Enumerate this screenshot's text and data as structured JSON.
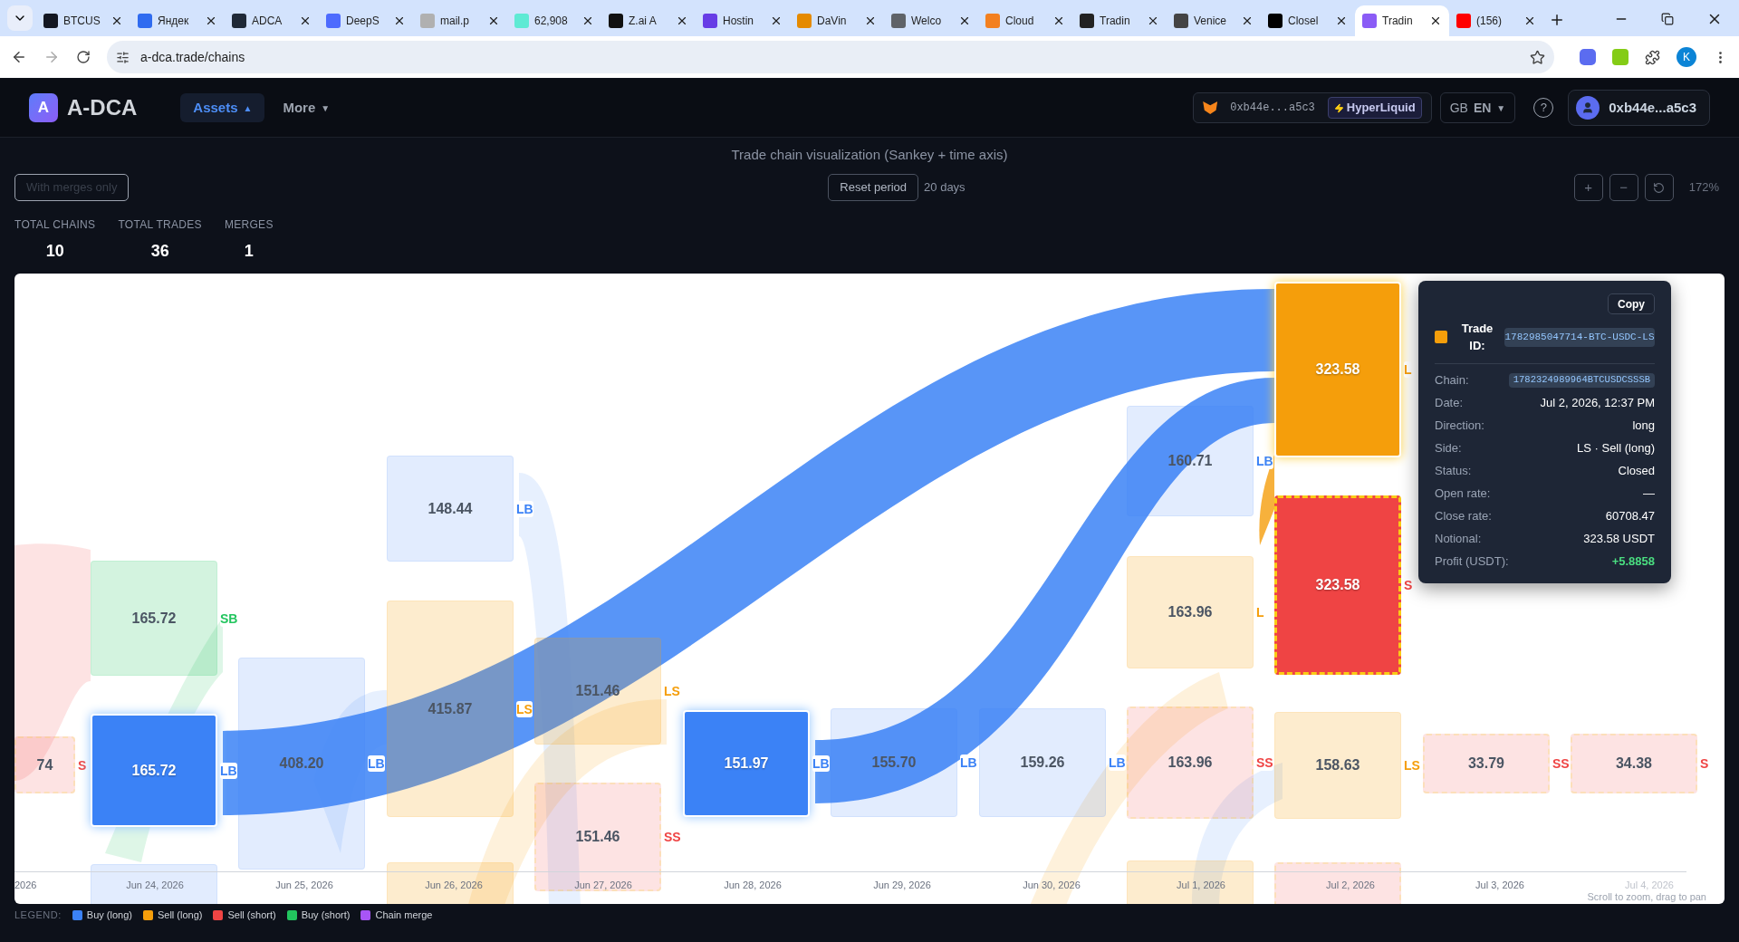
{
  "browser": {
    "tabs": [
      {
        "title": "BTCUS",
        "selected": false,
        "color": "#131722"
      },
      {
        "title": "Яндек",
        "selected": false,
        "color": "#2f6bf0"
      },
      {
        "title": "ADCA",
        "selected": false,
        "color": "#1f2937"
      },
      {
        "title": "DeepS",
        "selected": false,
        "color": "#4d6bfe"
      },
      {
        "title": "mail.p",
        "selected": false,
        "color": "#b0b0b0"
      },
      {
        "title": "62,908",
        "selected": false,
        "color": "#5eead4"
      },
      {
        "title": "Z.ai A",
        "selected": false,
        "color": "#111111"
      },
      {
        "title": "Hostin",
        "selected": false,
        "color": "#673de6"
      },
      {
        "title": "DaVin",
        "selected": false,
        "color": "#e58a00"
      },
      {
        "title": "Welco",
        "selected": false,
        "color": "#5f6368"
      },
      {
        "title": "Cloud",
        "selected": false,
        "color": "#f38020"
      },
      {
        "title": "Tradin",
        "selected": false,
        "color": "#222222"
      },
      {
        "title": "Venice",
        "selected": false,
        "color": "#444444"
      },
      {
        "title": "Closel",
        "selected": false,
        "color": "#000000"
      },
      {
        "title": "Tradin",
        "selected": true,
        "color": "#8b5cf6"
      },
      {
        "title": "(156)",
        "selected": false,
        "color": "#ff0000"
      }
    ],
    "url": "a-dca.trade/chains",
    "profile": "K"
  },
  "header": {
    "logo_letter": "A",
    "brand": "A-DCA",
    "nav": [
      {
        "label": "Assets",
        "caret": "▲",
        "selected": true
      },
      {
        "label": "More",
        "caret": "▼",
        "selected": false
      }
    ],
    "wallet": {
      "address": "0xb44e...a5c3",
      "network": "HyperLiquid"
    },
    "language": {
      "region": "GB",
      "code": "EN",
      "caret": "▼"
    },
    "help": "?",
    "account": "0xb44e...a5c3"
  },
  "toolbar": {
    "title": "Trade chain visualization (Sankey + time axis)",
    "filter": {
      "label": "With merges only",
      "on": false
    },
    "reset": "Reset period",
    "period": "20 days",
    "zoom_in": "+",
    "zoom_out": "−",
    "zoom_level": "172%"
  },
  "stats": [
    {
      "label": "TOTAL CHAINS",
      "value": "10"
    },
    {
      "label": "TOTAL TRADES",
      "value": "36"
    },
    {
      "label": "MERGES",
      "value": "1"
    }
  ],
  "chart": {
    "nodes": [
      {
        "value": "74",
        "tag": "S",
        "kind": "short-sell",
        "highlighted": false
      },
      {
        "value": "165.72",
        "tag": "SB",
        "kind": "short-buy",
        "highlighted": false
      },
      {
        "value": "165.72",
        "tag": "LB",
        "kind": "long-buy",
        "highlighted": true
      },
      {
        "value": "408.20",
        "tag": "LB",
        "kind": "long-buy",
        "highlighted": false
      },
      {
        "value": "148.44",
        "tag": "LB",
        "kind": "long-buy",
        "highlighted": false
      },
      {
        "value": "415.87",
        "tag": "LS",
        "kind": "long-sell",
        "highlighted": false
      },
      {
        "value": "151.46",
        "tag": "LS",
        "kind": "long-sell",
        "highlighted": false
      },
      {
        "value": "151.46",
        "tag": "SS",
        "kind": "short-sell",
        "highlighted": false
      },
      {
        "value": "151.97",
        "tag": "LB",
        "kind": "long-buy",
        "highlighted": true
      },
      {
        "value": "155.70",
        "tag": "LB",
        "kind": "long-buy",
        "highlighted": false
      },
      {
        "value": "159.26",
        "tag": "LB",
        "kind": "long-buy",
        "highlighted": false
      },
      {
        "value": "160.71",
        "tag": "LB",
        "kind": "long-buy",
        "highlighted": false
      },
      {
        "value": "163.96",
        "tag": "L",
        "kind": "long-sell",
        "highlighted": false
      },
      {
        "value": "163.96",
        "tag": "SS",
        "kind": "short-sell",
        "highlighted": false
      },
      {
        "value": "323.58",
        "tag": "L",
        "kind": "long-sell",
        "highlighted": true
      },
      {
        "value": "323.58",
        "tag": "S",
        "kind": "short-sell",
        "highlighted": true
      },
      {
        "value": "158.63",
        "tag": "LS",
        "kind": "long-sell",
        "highlighted": false
      },
      {
        "value": "33.79",
        "tag": "SS",
        "kind": "short-sell",
        "highlighted": false
      },
      {
        "value": "34.38",
        "tag": "S",
        "kind": "short-sell",
        "highlighted": false
      },
      {
        "kind": "long-buy",
        "highlighted": false
      },
      {
        "kind": "long-sell",
        "highlighted": false
      },
      {
        "kind": "long-sell",
        "highlighted": false
      },
      {
        "kind": "short-sell",
        "highlighted": false
      }
    ],
    "dates": [
      "2026",
      "Jun 24, 2026",
      "Jun 25, 2026",
      "Jun 26, 2026",
      "Jun 27, 2026",
      "Jun 28, 2026",
      "Jun 29, 2026",
      "Jun 30, 2026",
      "Jul 1, 2026",
      "Jul 2, 2026",
      "Jul 3, 2026",
      "Jul 4, 2026"
    ],
    "hint": "Scroll to zoom, drag to pan"
  },
  "tooltip": {
    "copy": "Copy",
    "color": "#f59e0b",
    "id_label": "Trade ID:",
    "id": "1782985047714-BTC-USDC-LS",
    "rows": [
      {
        "label": "Chain:",
        "value": "1782324989964BTCUSDCSSSB",
        "kind": "code"
      },
      {
        "label": "Date:",
        "value": "Jul 2, 2026, 12:37 PM",
        "kind": "text"
      },
      {
        "label": "Direction:",
        "value": "long",
        "kind": "text"
      },
      {
        "label": "Side:",
        "value": "LS · Sell (long)",
        "kind": "text"
      },
      {
        "label": "Status:",
        "value": "Closed",
        "kind": "text"
      },
      {
        "label": "Open rate:",
        "value": "—",
        "kind": "text"
      },
      {
        "label": "Close rate:",
        "value": "60708.47",
        "kind": "text"
      },
      {
        "label": "Notional:",
        "value": "323.58 USDT",
        "kind": "text"
      },
      {
        "label": "Profit (USDT):",
        "value": "+5.8858",
        "kind": "positive"
      }
    ]
  },
  "legend": {
    "title": "LEGEND:",
    "items": [
      {
        "label": "Buy (long)",
        "color": "#3b82f6"
      },
      {
        "label": "Sell (long)",
        "color": "#f59e0b"
      },
      {
        "label": "Sell (short)",
        "color": "#ef4444"
      },
      {
        "label": "Buy (short)",
        "color": "#22c55e"
      },
      {
        "label": "Chain merge",
        "color": "#a855f7"
      }
    ]
  }
}
